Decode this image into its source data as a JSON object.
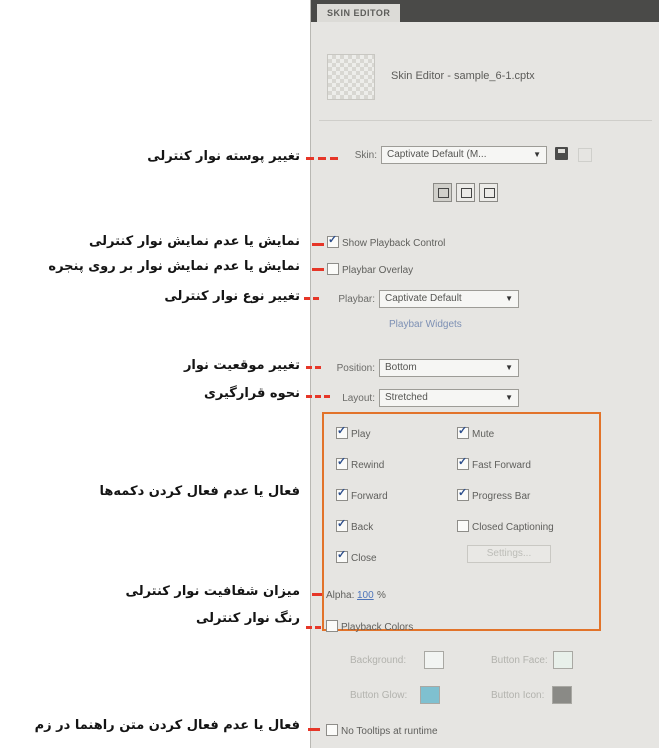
{
  "panel": {
    "tab": "SKIN EDITOR",
    "file_title": "Skin Editor - sample_6-1.cptx",
    "skin_label": "Skin:",
    "skin_value": "Captivate Default (M...",
    "show_playback_control": {
      "label": "Show Playback Control",
      "checked": true
    },
    "playbar_overlay": {
      "label": "Playbar Overlay",
      "checked": false
    },
    "playbar_label": "Playbar:",
    "playbar_value": "Captivate Default",
    "playbar_widgets": "Playbar Widgets",
    "position_label": "Position:",
    "position_value": "Bottom",
    "layout_label": "Layout:",
    "layout_value": "Stretched",
    "buttons": [
      {
        "label": "Play",
        "checked": true
      },
      {
        "label": "Mute",
        "checked": true
      },
      {
        "label": "Rewind",
        "checked": true
      },
      {
        "label": "Fast Forward",
        "checked": true
      },
      {
        "label": "Forward",
        "checked": true
      },
      {
        "label": "Progress Bar",
        "checked": true
      },
      {
        "label": "Back",
        "checked": true
      },
      {
        "label": "Closed Captioning",
        "checked": false
      },
      {
        "label": "Close",
        "checked": true
      }
    ],
    "settings_button": "Settings...",
    "alpha_label": "Alpha:",
    "alpha_value": "100",
    "alpha_unit": "%",
    "playback_colors": {
      "label": "Playback Colors",
      "checked": false
    },
    "background_label": "Background:",
    "button_face_label": "Button Face:",
    "button_glow_label": "Button Glow:",
    "button_icon_label": "Button Icon:",
    "no_tooltips": {
      "label": "No Tooltips at runtime",
      "checked": false
    },
    "colors": {
      "background": "#f2f4f2",
      "button_face": "#e8f0ea",
      "button_glow": "#7fc0d0",
      "button_icon": "#8a8a86"
    }
  },
  "annotations": [
    "تغییر پوسته نوار کنترلی",
    "نمایش یا عدم نمایش نوار کنترلی",
    "نمایش یا عدم نمایش نوار بر روی پنجره",
    "تغییر نوع نوار کنترلی",
    "تغییر موقعیت نوار",
    "نحوه قرارگیری",
    "فعال یا عدم فعال کردن دکمه‌ها",
    "میزان شفافیت نوار کنترلی",
    "رنگ نوار کنترلی",
    "فعال یا عدم فعال کردن متن راهنما در زم"
  ],
  "accent_colors": {
    "highlight_box": "#e2732a",
    "pointer": "#e63628"
  }
}
